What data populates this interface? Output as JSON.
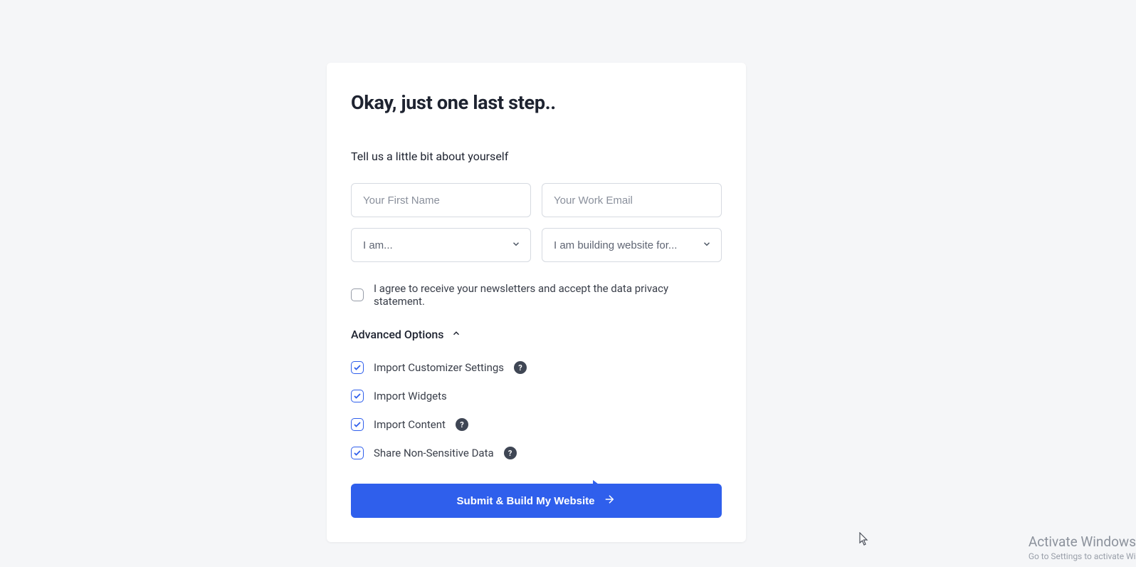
{
  "title": "Okay, just one last step..",
  "subtitle": "Tell us a little bit about yourself",
  "fields": {
    "first_name_placeholder": "Your First Name",
    "work_email_placeholder": "Your Work Email",
    "role_placeholder": "I am...",
    "building_for_placeholder": "I am building website for..."
  },
  "consent_label": "I agree to receive your newsletters and accept the data privacy statement.",
  "advanced_label": "Advanced Options",
  "options": {
    "import_customizer": "Import Customizer Settings",
    "import_widgets": "Import Widgets",
    "import_content": "Import Content",
    "share_data": "Share Non-Sensitive Data"
  },
  "submit_label": "Submit & Build My Website",
  "watermark": {
    "line1": "Activate Windows",
    "line2": "Go to Settings to activate Wi"
  }
}
